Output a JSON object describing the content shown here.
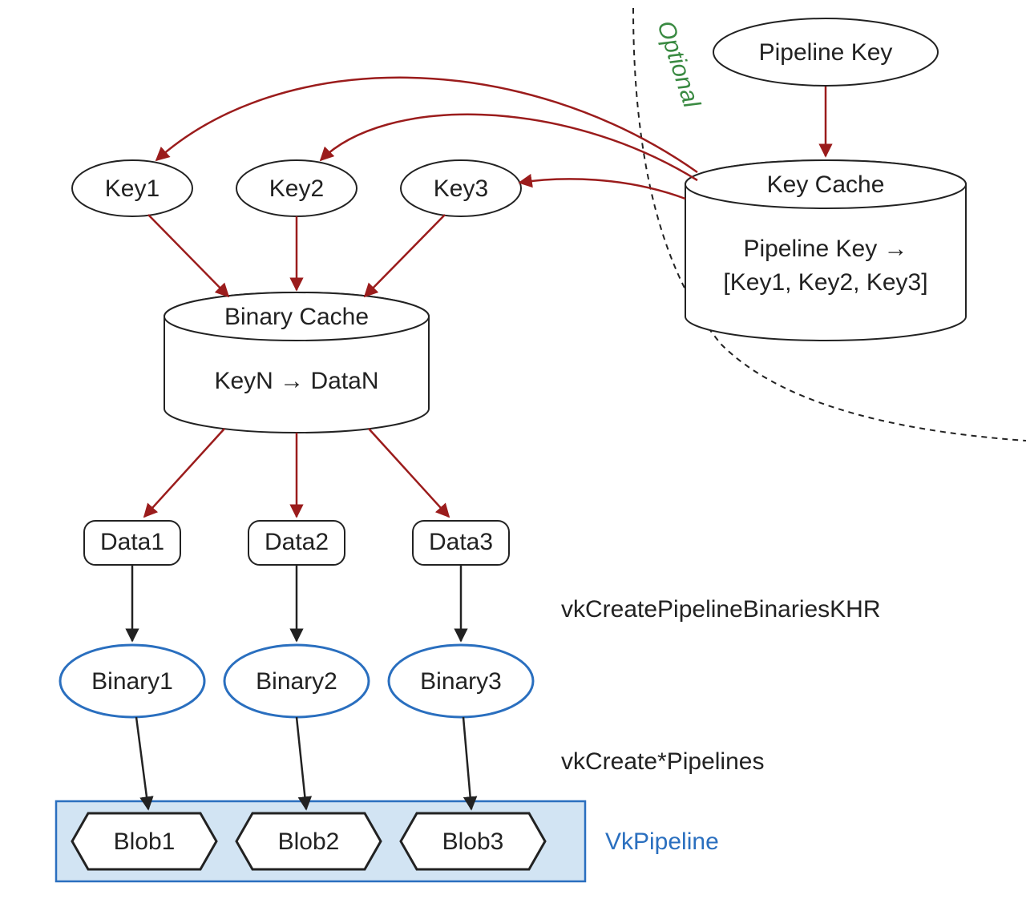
{
  "nodes": {
    "pipeline_key": "Pipeline Key",
    "key1": "Key1",
    "key2": "Key2",
    "key3": "Key3",
    "key_cache_title": "Key Cache",
    "key_cache_line1": "Pipeline Key →",
    "key_cache_line2": "[Key1, Key2, Key3]",
    "binary_cache_title": "Binary Cache",
    "binary_cache_line1": "KeyN → DataN",
    "data1": "Data1",
    "data2": "Data2",
    "data3": "Data3",
    "binary1": "Binary1",
    "binary2": "Binary2",
    "binary3": "Binary3",
    "blob1": "Blob1",
    "blob2": "Blob2",
    "blob3": "Blob3"
  },
  "labels": {
    "optional": "Optional",
    "create_binaries": "vkCreatePipelineBinariesKHR",
    "create_pipelines": "vkCreate*Pipelines",
    "vkpipeline": "VkPipeline"
  },
  "colors": {
    "red": "#9b1c1c",
    "black": "#222222",
    "blue": "#2a6fbf",
    "lightblue_fill": "#d2e4f3",
    "green": "#3a8a42"
  }
}
